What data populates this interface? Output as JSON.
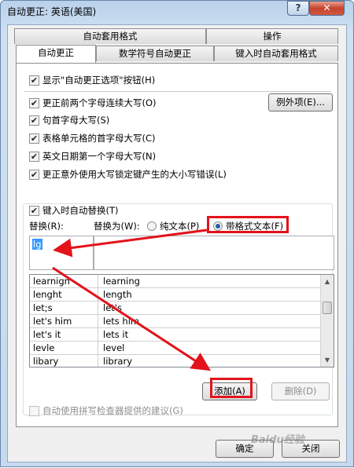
{
  "window": {
    "title": "自动更正: 英语(美国)",
    "help_label": "?",
    "close_label": "✕"
  },
  "tabs": [
    {
      "label": "自动套用格式"
    },
    {
      "label": "操作"
    },
    {
      "label": "自动更正"
    },
    {
      "label": "数学符号自动更正"
    },
    {
      "label": "键入时自动套用格式"
    }
  ],
  "options": {
    "show_buttons": "显示\"自动更正选项\"按钮(H)",
    "two_initial_caps": "更正前两个字母连续大写(O)",
    "capitalize_sentence": "句首字母大写(S)",
    "capitalize_table_cell": "表格单元格的首字母大写(C)",
    "capitalize_day_names": "英文日期第一个字母大写(N)",
    "caps_lock": "更正意外使用大写锁定键产生的大小写错误(L)",
    "exceptions_button": "例外项(E)...",
    "replace_as_type": "键入时自动替换(T)"
  },
  "replace": {
    "replace_label": "替换(R):",
    "with_label": "替换为(W):",
    "plain_text": "纯文本(P)",
    "formatted_text": "带格式文本(F)",
    "replace_value": "lg",
    "with_value": ""
  },
  "entries": [
    {
      "from": "learnign",
      "to": "learning"
    },
    {
      "from": "lenght",
      "to": "length"
    },
    {
      "from": "let;s",
      "to": "let's"
    },
    {
      "from": "let's him",
      "to": "lets him"
    },
    {
      "from": "let's it",
      "to": "lets it"
    },
    {
      "from": "levle",
      "to": "level"
    },
    {
      "from": "libary",
      "to": "library"
    }
  ],
  "actions": {
    "add": "添加(A)",
    "delete": "删除(D)",
    "spell_checker": "自动使用拼写检查器提供的建议(G)",
    "ok": "确定",
    "close": "关闭"
  },
  "watermark": "Baidu经验",
  "colors": {
    "highlight": "#e2131b",
    "title_gradient_top": "#b9d1ea",
    "dialog_bg": "#f0f0f0"
  }
}
